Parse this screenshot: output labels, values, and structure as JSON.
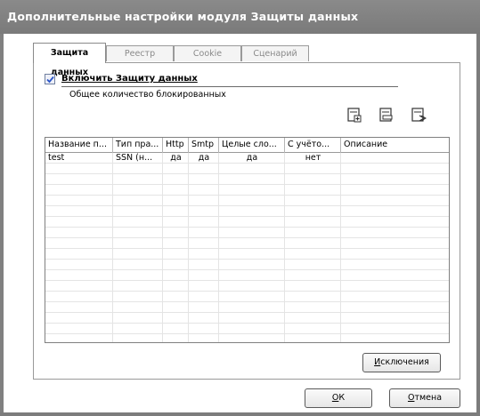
{
  "window": {
    "title": "Дополнительные настройки модуля Защиты данных"
  },
  "tabs": [
    {
      "label": "Защита данных",
      "active": true
    },
    {
      "label": "Реестр",
      "active": false
    },
    {
      "label": "Cookie",
      "active": false
    },
    {
      "label": "Сценарий",
      "active": false
    }
  ],
  "protection": {
    "enable_label": "Включить Защиту данных",
    "enabled": true,
    "blocked_count_label": "Общее количество блокированных"
  },
  "toolbar": {
    "icons": [
      "add-rule-icon",
      "edit-rule-icon",
      "delete-rule-icon"
    ]
  },
  "table": {
    "columns": [
      "Название п...",
      "Тип пра...",
      "Http",
      "Smtp",
      "Целые сло...",
      "С учёто...",
      "Описание"
    ],
    "rows": [
      [
        "test",
        "SSN (н...",
        "да",
        "да",
        "да",
        "нет",
        ""
      ]
    ]
  },
  "buttons": {
    "exclusions_first": "И",
    "exclusions_rest": "сключения",
    "ok_first": "О",
    "ok_rest": "К",
    "cancel_first": "О",
    "cancel_rest": "тмена"
  },
  "colors": {
    "titlebar": "#808080",
    "checkbox_check": "#2a55c8"
  }
}
